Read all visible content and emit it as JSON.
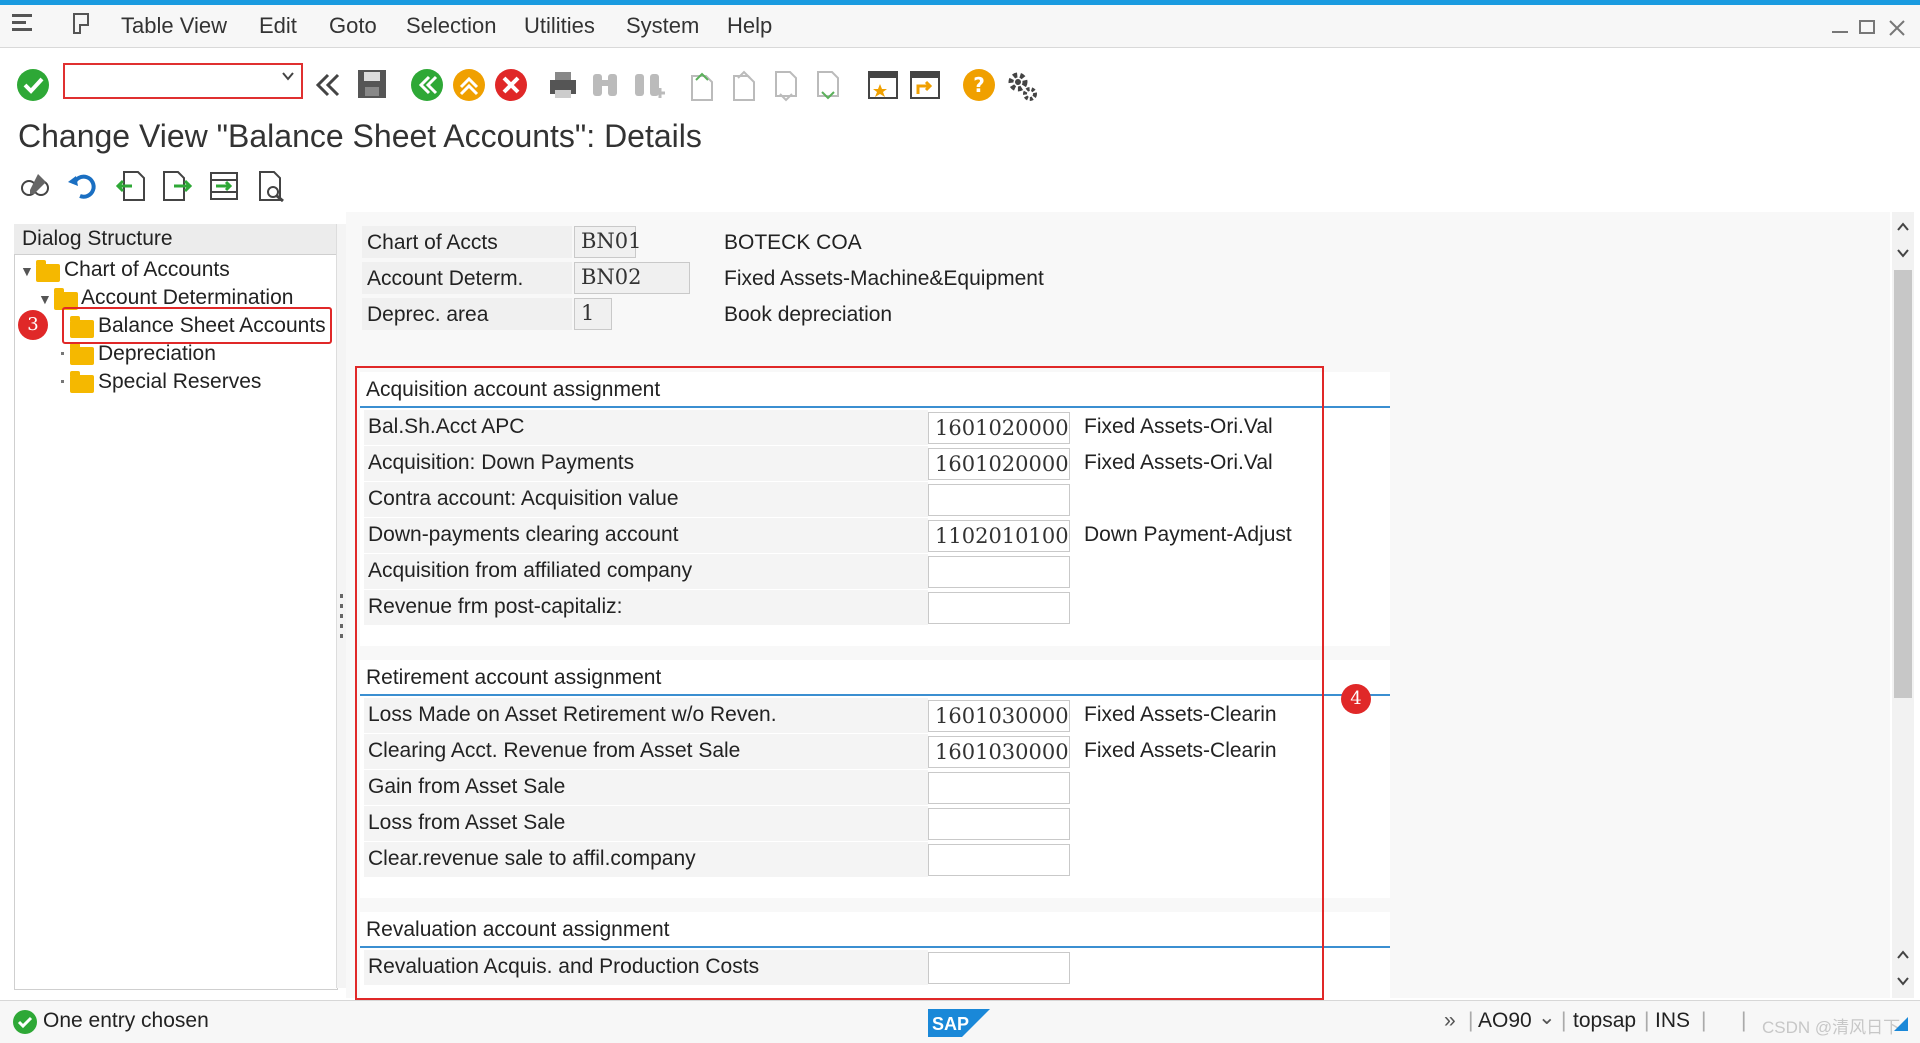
{
  "menu": {
    "items": [
      "Table View",
      "Edit",
      "Goto",
      "Selection",
      "Utilities",
      "System",
      "Help"
    ]
  },
  "toolbar": {
    "command_value": ""
  },
  "page": {
    "title": "Change View \"Balance Sheet Accounts\": Details"
  },
  "tree": {
    "header": "Dialog Structure",
    "nodes": [
      "Chart of Accounts",
      "Account Determination",
      "Balance Sheet Accounts",
      "Depreciation",
      "Special Reserves"
    ]
  },
  "header_fields": [
    {
      "label": "Chart of Accts",
      "value": "BN01",
      "desc": "BOTECK COA"
    },
    {
      "label": "Account Determ.",
      "value": "BN02",
      "desc": "Fixed Assets-Machine&Equipment"
    },
    {
      "label": "Deprec. area",
      "value": "1",
      "desc": "Book depreciation"
    }
  ],
  "groups": {
    "acquisition": {
      "title": "Acquisition account assignment",
      "rows": [
        {
          "label": "Bal.Sh.Acct APC",
          "value": "1601020000",
          "desc": "Fixed Assets-Ori.Val"
        },
        {
          "label": "Acquisition: Down Payments",
          "value": "1601020000",
          "desc": "Fixed Assets-Ori.Val"
        },
        {
          "label": "Contra account: Acquisition value",
          "value": "",
          "desc": ""
        },
        {
          "label": "Down-payments clearing account",
          "value": "1102010100",
          "desc": "Down Payment-Adjust"
        },
        {
          "label": "Acquisition from affiliated company",
          "value": "",
          "desc": ""
        },
        {
          "label": "Revenue frm post-capitaliz:",
          "value": "",
          "desc": ""
        }
      ]
    },
    "retirement": {
      "title": "Retirement account assignment",
      "rows": [
        {
          "label": "Loss Made on Asset Retirement w/o Reven.",
          "value": "1601030000",
          "desc": "Fixed Assets-Clearin"
        },
        {
          "label": "Clearing Acct. Revenue from Asset Sale",
          "value": "1601030000",
          "desc": "Fixed Assets-Clearin"
        },
        {
          "label": "Gain from Asset Sale",
          "value": "",
          "desc": ""
        },
        {
          "label": "Loss from Asset Sale",
          "value": "",
          "desc": ""
        },
        {
          "label": "Clear.revenue sale to affil.company",
          "value": "",
          "desc": ""
        }
      ]
    },
    "revaluation": {
      "title": "Revaluation account assignment",
      "rows": [
        {
          "label": "Revaluation Acquis. and Production Costs",
          "value": "",
          "desc": ""
        }
      ]
    }
  },
  "annotations": {
    "badge_tree": "3",
    "badge_content": "4"
  },
  "status": {
    "message": "One entry chosen",
    "brand": "SAP",
    "tcode": "AO90",
    "server": "topsap",
    "mode": "INS",
    "chevron": "»",
    "dropdown": "⌄",
    "separator": "|",
    "watermark": "CSDN @清风日下"
  },
  "colors": {
    "accent": "#1a9be0",
    "annotation": "#e02828",
    "group_line": "#3b8fd1",
    "folder": "#f5b800"
  }
}
